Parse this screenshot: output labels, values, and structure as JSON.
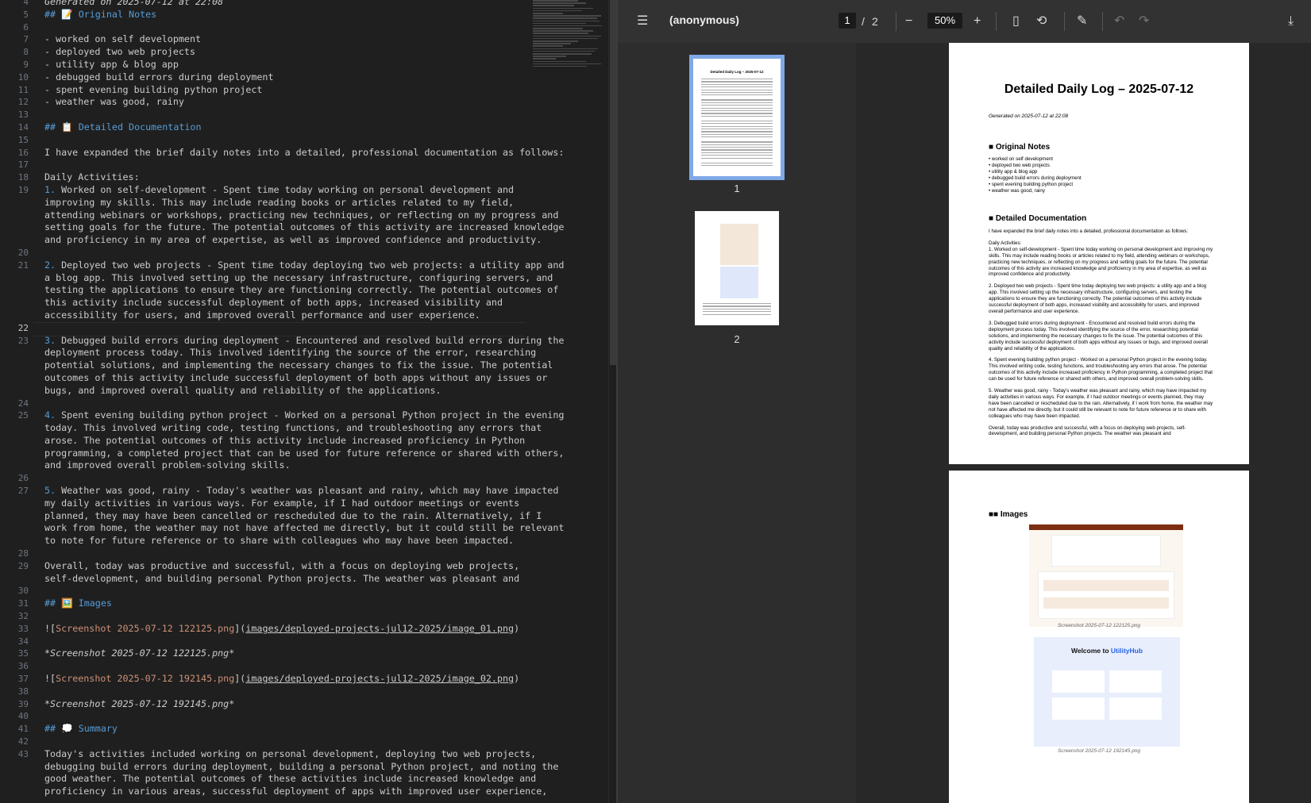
{
  "editor": {
    "lines": [
      {
        "n": "4",
        "t": "Generated on 2025-07-12 at 22:08",
        "s": "it"
      },
      {
        "n": "5",
        "t": "## 📝 Original Notes",
        "s": "h"
      },
      {
        "n": "6",
        "t": ""
      },
      {
        "n": "7",
        "t": "- worked on self development"
      },
      {
        "n": "8",
        "t": "- deployed two web projects"
      },
      {
        "n": "9",
        "t": "- utility app & blog app"
      },
      {
        "n": "10",
        "t": "- debugged build errors during deployment"
      },
      {
        "n": "11",
        "t": "- spent evening building python project"
      },
      {
        "n": "12",
        "t": "- weather was good, rainy"
      },
      {
        "n": "13",
        "t": ""
      },
      {
        "n": "14",
        "t": "## 📋 Detailed Documentation",
        "s": "h"
      },
      {
        "n": "15",
        "t": ""
      },
      {
        "n": "16",
        "t": "I have expanded the brief daily notes into a detailed, professional documentation as follows:"
      },
      {
        "n": "17",
        "t": ""
      },
      {
        "n": "18",
        "t": "Daily Activities:"
      },
      {
        "n": "19",
        "t": "1. Worked on self-development - Spent time today working on personal development and",
        "num": "1."
      },
      {
        "n": "",
        "t": "improving my skills. This may include reading books or articles related to my field,"
      },
      {
        "n": "",
        "t": "attending webinars or workshops, practicing new techniques, or reflecting on my progress and"
      },
      {
        "n": "",
        "t": "setting goals for the future. The potential outcomes of this activity are increased knowledge"
      },
      {
        "n": "",
        "t": "and proficiency in my area of expertise, as well as improved confidence and productivity."
      },
      {
        "n": "20",
        "t": ""
      },
      {
        "n": "21",
        "t": "2. Deployed two web projects - Spent time today deploying two web projects: a utility app and",
        "num": "2."
      },
      {
        "n": "",
        "t": "a blog app. This involved setting up the necessary infrastructure, configuring servers, and"
      },
      {
        "n": "",
        "t": "testing the applications to ensure they are functioning correctly. The potential outcomes of"
      },
      {
        "n": "",
        "t": "this activity include successful deployment of both apps, increased visibility and"
      },
      {
        "n": "",
        "t": "accessibility for users, and improved overall performance and user experience."
      },
      {
        "n": "22",
        "t": "",
        "cur": true
      },
      {
        "n": "23",
        "t": "3. Debugged build errors during deployment - Encountered and resolved build errors during the",
        "num": "3."
      },
      {
        "n": "",
        "t": "deployment process today. This involved identifying the source of the error, researching"
      },
      {
        "n": "",
        "t": "potential solutions, and implementing the necessary changes to fix the issue. The potential"
      },
      {
        "n": "",
        "t": "outcomes of this activity include successful deployment of both apps without any issues or"
      },
      {
        "n": "",
        "t": "bugs, and improved overall quality and reliability of the applications."
      },
      {
        "n": "24",
        "t": ""
      },
      {
        "n": "25",
        "t": "4. Spent evening building python project - Worked on a personal Python project in the evening",
        "num": "4."
      },
      {
        "n": "",
        "t": "today. This involved writing code, testing functions, and troubleshooting any errors that"
      },
      {
        "n": "",
        "t": "arose. The potential outcomes of this activity include increased proficiency in Python"
      },
      {
        "n": "",
        "t": "programming, a completed project that can be used for future reference or shared with others,"
      },
      {
        "n": "",
        "t": "and improved overall problem-solving skills."
      },
      {
        "n": "26",
        "t": ""
      },
      {
        "n": "27",
        "t": "5. Weather was good, rainy - Today's weather was pleasant and rainy, which may have impacted",
        "num": "5."
      },
      {
        "n": "",
        "t": "my daily activities in various ways. For example, if I had outdoor meetings or events"
      },
      {
        "n": "",
        "t": "planned, they may have been cancelled or rescheduled due to the rain. Alternatively, if I"
      },
      {
        "n": "",
        "t": "work from home, the weather may not have affected me directly, but it could still be relevant"
      },
      {
        "n": "",
        "t": "to note for future reference or to share with colleagues who may have been impacted."
      },
      {
        "n": "28",
        "t": ""
      },
      {
        "n": "29",
        "t": "Overall, today was productive and successful, with a focus on deploying web projects,"
      },
      {
        "n": "",
        "t": "self-development, and building personal Python projects. The weather was pleasant and"
      },
      {
        "n": "30",
        "t": ""
      },
      {
        "n": "31",
        "t": "## 🖼️ Images",
        "s": "h"
      },
      {
        "n": "32",
        "t": ""
      },
      {
        "n": "33",
        "link": "Screenshot 2025-07-12 122125.png",
        "url": "images/deployed-projects-jul12-2025/image_01.png"
      },
      {
        "n": "34",
        "t": ""
      },
      {
        "n": "35",
        "t": "*Screenshot 2025-07-12 122125.png*",
        "s": "it"
      },
      {
        "n": "36",
        "t": ""
      },
      {
        "n": "37",
        "link": "Screenshot 2025-07-12 192145.png",
        "url": "images/deployed-projects-jul12-2025/image_02.png"
      },
      {
        "n": "38",
        "t": ""
      },
      {
        "n": "39",
        "t": "*Screenshot 2025-07-12 192145.png*",
        "s": "it"
      },
      {
        "n": "40",
        "t": ""
      },
      {
        "n": "41",
        "t": "## 💭 Summary",
        "s": "h"
      },
      {
        "n": "42",
        "t": ""
      },
      {
        "n": "43",
        "t": "Today's activities included working on personal development, deploying two web projects,"
      },
      {
        "n": "",
        "t": "debugging build errors during deployment, building a personal Python project, and noting the"
      },
      {
        "n": "",
        "t": "good weather. The potential outcomes of these activities include increased knowledge and"
      },
      {
        "n": "",
        "t": "proficiency in various areas, successful deployment of apps with improved user experience,"
      }
    ]
  },
  "viewer": {
    "doc_title": "(anonymous)",
    "page_current": "1",
    "page_sep": "/",
    "page_total": "2",
    "zoom": "50%",
    "thumbs": [
      {
        "label": "1"
      },
      {
        "label": "2"
      }
    ],
    "icons": {
      "menu": "☰",
      "zoom_out": "−",
      "zoom_in": "+",
      "page_fit": "▯",
      "rotate": "⟲",
      "draw": "✎",
      "undo": "↶",
      "redo": "↷",
      "download": "⤓"
    }
  },
  "pdf": {
    "title": "Detailed Daily Log – 2025-07-12",
    "generated": "Generated on 2025-07-12 at 22:08",
    "h_original": "■ Original Notes",
    "notes": [
      "• worked on self development",
      "• deployed two web projects",
      "• utility app & blog app",
      "• debugged build errors during deployment",
      "• spent evening building python project",
      "• weather was good, rainy"
    ],
    "h_detailed": "■ Detailed Documentation",
    "intro": "I have expanded the brief daily notes into a detailed, professional documentation as follows:",
    "daily": "Daily Activities:",
    "items": [
      "1. Worked on self-development - Spent time today working on personal development and improving my skills. This may include reading books or articles related to my field, attending webinars or workshops, practicing new techniques, or reflecting on my progress and setting goals for the future. The potential outcomes of this activity are increased knowledge and proficiency in my area of expertise, as well as improved confidence and productivity.",
      "2. Deployed two web projects - Spent time today deploying two web projects: a utility app and a blog app. This involved setting up the necessary infrastructure, configuring servers, and testing the applications to ensure they are functioning correctly. The potential outcomes of this activity include successful deployment of both apps, increased visibility and accessibility for users, and improved overall performance and user experience.",
      "3. Debugged build errors during deployment - Encountered and resolved build errors during the deployment process today. This involved identifying the source of the error, researching potential solutions, and implementing the necessary changes to fix the issue. The potential outcomes of this activity include successful deployment of both apps without any issues or bugs, and improved overall quality and reliability of the applications.",
      "4. Spent evening building python project - Worked on a personal Python project in the evening today. This involved writing code, testing functions, and troubleshooting any errors that arose. The potential outcomes of this activity include increased proficiency in Python programming, a completed project that can be used for future reference or shared with others, and improved overall problem-solving skills.",
      "5. Weather was good, rainy - Today's weather was pleasant and rainy, which may have impacted my daily activities in various ways. For example, if I had outdoor meetings or events planned, they may have been cancelled or rescheduled due to the rain. Alternatively, if I work from home, the weather may not have affected me directly, but it could still be relevant to note for future reference or to share with colleagues who may have been impacted.",
      "Overall, today was productive and successful, with a focus on deploying web projects, self-development, and building personal Python projects. The weather was pleasant and"
    ],
    "h_images": "■■ Images",
    "cap1": "Screenshot 2025-07-12 122125.png",
    "cap2": "Screenshot 2025-07-12 192145.png",
    "shot2_heading_prefix": "Welcome to ",
    "shot2_heading_brand": "UtilityHub"
  },
  "colors": {
    "heading": "#569cd6",
    "link": "#ce9178",
    "thumb_sel": "#7fa9e6",
    "hub_bg": "#e8eefc",
    "hub_accent": "#2563eb",
    "blog_accent": "#c2410c"
  }
}
